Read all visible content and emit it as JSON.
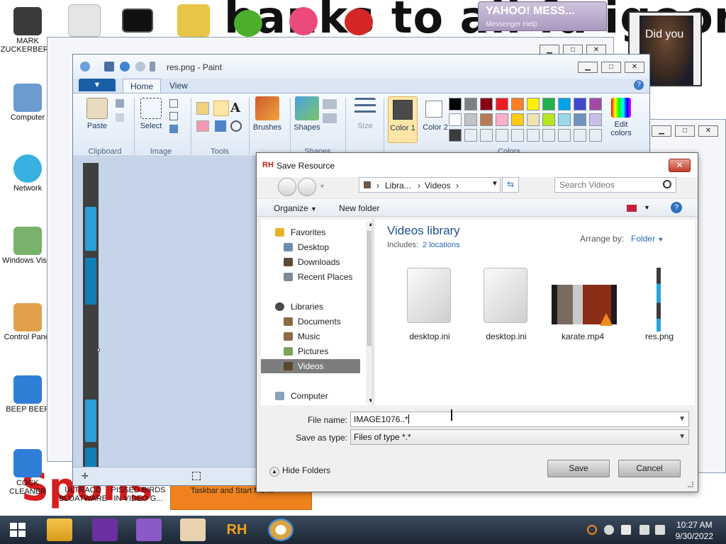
{
  "desktop": {
    "banner_text": "hanks to all fa  igoors",
    "spons_text": "Spons",
    "icons": [
      {
        "label": "MARK ZUCKERBERG"
      },
      {
        "label": "Computer"
      },
      {
        "label": "Network"
      },
      {
        "label": "Windows Vista"
      },
      {
        "label": "Control Panel"
      },
      {
        "label": "BEEP BEEP"
      },
      {
        "label": "COCK CLEANER"
      },
      {
        "label": "ULTRACD BLOATWARE"
      },
      {
        "label": "PISSED BIRDS IN VIDEO G..."
      }
    ],
    "yahoo": {
      "title": "YAHOO! MESS...",
      "sub": "Messenger   Help"
    },
    "obama_caption": "Did you",
    "orange_bar_text": "Taskbar and Start Menu"
  },
  "paint": {
    "title": "res.png - Paint",
    "file_tab": "▼",
    "tabs": [
      "Home",
      "View"
    ],
    "groups": {
      "clipboard": "Clipboard",
      "image": "Image",
      "tools": "Tools",
      "shapes": "Shapes",
      "colors": "Colors"
    },
    "buttons": {
      "paste": "Paste",
      "select": "Select",
      "brushes": "Brushes",
      "shapes": "Shapes",
      "size": "Size",
      "color1": "Color 1",
      "color2": "Color 2",
      "edit_colors": "Edit colors"
    },
    "palette_row1": [
      "#000000",
      "#7f7f7f",
      "#880015",
      "#ed1c24",
      "#ff7f27",
      "#fff200",
      "#22b14c",
      "#00a2e8",
      "#3f48cc",
      "#a349a4"
    ],
    "palette_row2": [
      "#ffffff",
      "#c3c3c3",
      "#b97a57",
      "#ffaec9",
      "#ffc90e",
      "#efe4b0",
      "#b5e61d",
      "#99d9ea",
      "#7092be",
      "#c8bfe7"
    ],
    "color1_value": "#4a4a4a",
    "color2_value": "#ffffff"
  },
  "dialog": {
    "title": "Save Resource",
    "close": "✕",
    "breadcrumb": [
      "Libra...",
      "Videos"
    ],
    "search_placeholder": "Search Videos",
    "organize": "Organize",
    "new_folder": "New folder",
    "nav": {
      "favorites": "Favorites",
      "desktop": "Desktop",
      "downloads": "Downloads",
      "recent": "Recent Places",
      "libraries": "Libraries",
      "documents": "Documents",
      "music": "Music",
      "pictures": "Pictures",
      "videos": "Videos",
      "computer": "Computer"
    },
    "library_title": "Videos library",
    "includes_label": "Includes:",
    "includes_link": "2 locations",
    "arrange_label": "Arrange by:",
    "arrange_value": "Folder",
    "files": [
      "desktop.ini",
      "desktop.ini",
      "karate.mp4",
      "res.png"
    ],
    "file_name_label": "File name:",
    "file_name_value": "IMAGE1076..*",
    "save_type_label": "Save as type:",
    "save_type_value": "Files of type *.*",
    "hide_folders": "Hide Folders",
    "save": "Save",
    "cancel": "Cancel"
  },
  "taskbar": {
    "time": "10:27 AM",
    "date": "9/30/2022"
  }
}
